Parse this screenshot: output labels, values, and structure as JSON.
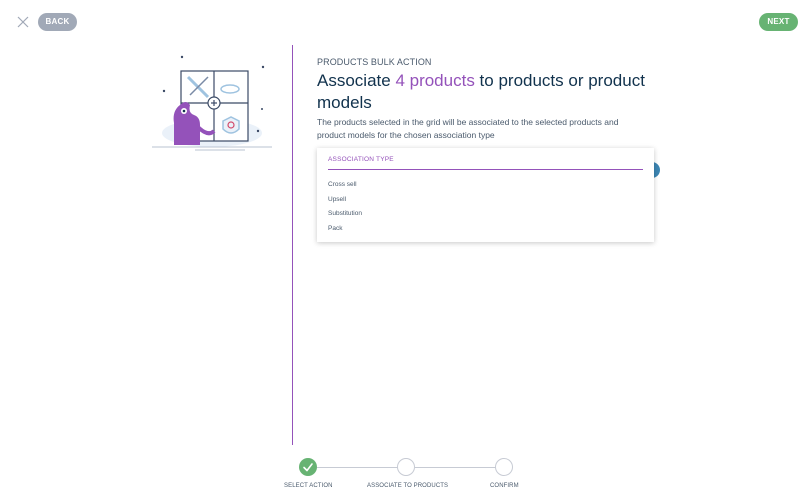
{
  "header": {
    "back_label": "BACK",
    "next_label": "NEXT",
    "close_icon": "close-icon"
  },
  "main": {
    "subtitle": "PRODUCTS BULK ACTION",
    "title_prefix": "Associate ",
    "title_count": "4 products",
    "title_suffix": " to products or product models",
    "description": "The products selected in the grid will be associated to the selected products and product models for the chosen association type"
  },
  "dropdown": {
    "header": "ASSOCIATION TYPE",
    "options": [
      "Cross sell",
      "Upsell",
      "Substitution",
      "Pack"
    ]
  },
  "stepper": {
    "steps": [
      {
        "label": "SELECT ACTION",
        "state": "done"
      },
      {
        "label": "ASSOCIATE TO PRODUCTS",
        "state": "todo"
      },
      {
        "label": "CONFIRM",
        "state": "todo"
      }
    ]
  },
  "colors": {
    "accent": "#9452ba",
    "success": "#67b373",
    "muted_button": "#a1a9b7",
    "blue": "#3c86b3"
  }
}
